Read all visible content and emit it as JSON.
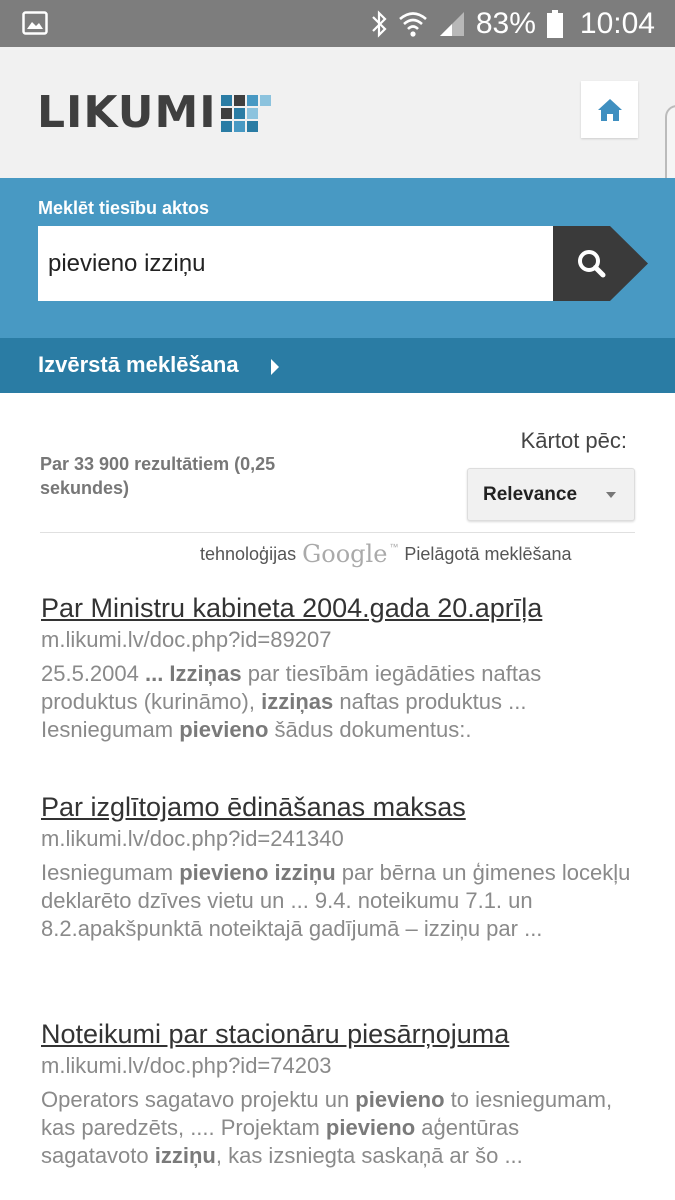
{
  "status_bar": {
    "battery": "83%",
    "time": "10:04",
    "icons": [
      "gallery-icon",
      "bluetooth-icon",
      "wifi-icon",
      "signal-icon",
      "battery-icon"
    ]
  },
  "header": {
    "logo_text": "LIKUMI",
    "home_icon": "home-icon"
  },
  "search": {
    "label": "Meklēt tiesību aktos",
    "value": "pievieno izziņu",
    "button_icon": "search-icon"
  },
  "advanced": {
    "label": "Izvērstā meklēšana"
  },
  "results_info": {
    "text": "Par 33 900 rezultātiem (0,25 sekundes)"
  },
  "sort": {
    "label": "Kārtot pēc:",
    "selected": "Relevance"
  },
  "powered_by": {
    "prefix": "tehnoloģijas",
    "brand": "Google",
    "tm": "™",
    "suffix": "Pielāgotā meklēšana"
  },
  "results": [
    {
      "title": "Par Ministru kabineta 2004.gada 20.aprīļa",
      "url": "m.likumi.lv/doc.php?id=89207",
      "snippet": [
        {
          "t": "25.5.2004 ",
          "b": false
        },
        {
          "t": "... Izziņas",
          "b": true
        },
        {
          "t": " par tiesībām iegādāties naftas produktus (kurināmo), ",
          "b": false
        },
        {
          "t": "izziņas",
          "b": true
        },
        {
          "t": " naftas produktus ... Iesniegumam ",
          "b": false
        },
        {
          "t": "pievieno",
          "b": true
        },
        {
          "t": " šādus dokumentus:.",
          "b": false
        }
      ]
    },
    {
      "title": "Par izglītojamo ēdināšanas maksas",
      "url": "m.likumi.lv/doc.php?id=241340",
      "snippet": [
        {
          "t": "Iesniegumam ",
          "b": false
        },
        {
          "t": "pievieno izziņu",
          "b": true
        },
        {
          "t": " par bērna un ģimenes locekļu deklarēto dzīves vietu un ... 9.4. noteikumu 7.1. un 8.2.apakšpunktā noteiktajā gadījumā – izziņu par ...",
          "b": false
        }
      ]
    },
    {
      "title": "Noteikumi par stacionāru piesārņojuma",
      "url": "m.likumi.lv/doc.php?id=74203",
      "snippet": [
        {
          "t": "Operators sagatavo projektu un ",
          "b": false
        },
        {
          "t": "pievieno",
          "b": true
        },
        {
          "t": " to iesniegumam, kas paredzēts, .... Projektam ",
          "b": false
        },
        {
          "t": "pievieno",
          "b": true
        },
        {
          "t": " aģentūras sagatavoto ",
          "b": false
        },
        {
          "t": "izziņu",
          "b": true
        },
        {
          "t": ", kas izsniegta saskaņā ar šo ...",
          "b": false
        }
      ]
    }
  ],
  "colors": {
    "search_panel": "#4899c3",
    "advanced_bar": "#2a7ca4",
    "logo_grid": [
      "#2a7ca4",
      "#4899c3",
      "#8cc3de",
      "#3f3f3f"
    ]
  }
}
